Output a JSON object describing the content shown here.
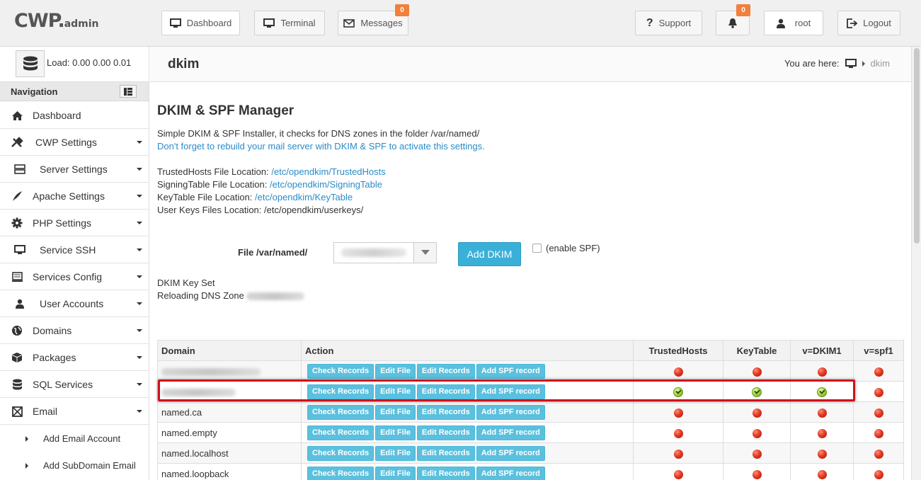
{
  "logo": {
    "main": "CWP",
    "dot": ".",
    "sub": "admin"
  },
  "topnav": {
    "dashboard": "Dashboard",
    "terminal": "Terminal",
    "messages": "Messages",
    "messages_count": "0",
    "support": "Support",
    "notifications_count": "0",
    "user": "root",
    "logout": "Logout"
  },
  "sidebar": {
    "load": "Load: 0.00  0.00  0.01",
    "nav_title": "Navigation",
    "items": [
      {
        "label": "Dashboard",
        "icon": "home-icon"
      },
      {
        "label": "CWP Settings",
        "icon": "tools-icon"
      },
      {
        "label": "Server Settings",
        "icon": "server-icon"
      },
      {
        "label": "Apache Settings",
        "icon": "feather-icon"
      },
      {
        "label": "PHP Settings",
        "icon": "gear-icon"
      },
      {
        "label": "Service SSH",
        "icon": "monitor-icon"
      },
      {
        "label": "Services Config",
        "icon": "list-icon"
      },
      {
        "label": "User Accounts",
        "icon": "user-icon"
      },
      {
        "label": "Domains",
        "icon": "globe-icon"
      },
      {
        "label": "Packages",
        "icon": "box-icon"
      },
      {
        "label": "SQL Services",
        "icon": "database-icon"
      },
      {
        "label": "Email",
        "icon": "envelope-icon"
      }
    ],
    "subitems": [
      {
        "label": "Add Email Account"
      },
      {
        "label": "Add SubDomain Email"
      }
    ]
  },
  "page": {
    "title": "dkim",
    "breadcrumb_label": "You are here:",
    "breadcrumb_current": "dkim"
  },
  "manager": {
    "heading": "DKIM & SPF Manager",
    "desc1": "Simple DKIM & SPF Installer, it checks for DNS zones in the folder /var/named/",
    "desc2": "Don't forget to rebuild your mail server with DKIM & SPF to activate this settings.",
    "trusted_label": "TrustedHosts File Location:",
    "trusted_path": "/etc/opendkim/TrustedHosts",
    "signing_label": "SigningTable File Location:",
    "signing_path": "/etc/opendkim/SigningTable",
    "keytable_label": "KeyTable File Location:",
    "keytable_path": "/etc/opendkim/KeyTable",
    "userkeys_label": "User Keys Files Location:",
    "userkeys_path": "/etc/opendkim/userkeys/",
    "file_label": "File /var/named/",
    "add_button": "Add DKIM",
    "enable_spf": "(enable SPF)",
    "status1": "DKIM Key Set",
    "status2": "Reloading DNS Zone"
  },
  "table": {
    "headers": [
      "Domain",
      "Action",
      "TrustedHosts",
      "KeyTable",
      "v=DKIM1",
      "v=spf1"
    ],
    "action_labels": {
      "check": "Check Records",
      "edit_file": "Edit File",
      "edit_records": "Edit Records",
      "add_spf": "Add SPF record"
    },
    "rows": [
      {
        "domain": "",
        "blurred": true,
        "trusted": "red",
        "keytable": "red",
        "dkim": "red",
        "spf": "red"
      },
      {
        "domain": "",
        "blurred": true,
        "trusted": "green",
        "keytable": "green",
        "dkim": "green",
        "spf": "red"
      },
      {
        "domain": "named.ca",
        "blurred": false,
        "trusted": "red",
        "keytable": "red",
        "dkim": "red",
        "spf": "red"
      },
      {
        "domain": "named.empty",
        "blurred": false,
        "trusted": "red",
        "keytable": "red",
        "dkim": "red",
        "spf": "red"
      },
      {
        "domain": "named.localhost",
        "blurred": false,
        "trusted": "red",
        "keytable": "red",
        "dkim": "red",
        "spf": "red"
      },
      {
        "domain": "named.loopback",
        "blurred": false,
        "trusted": "red",
        "keytable": "red",
        "dkim": "red",
        "spf": "red"
      }
    ]
  },
  "colors": {
    "accent": "#3ab0d8",
    "link": "#2a8bc8",
    "badge": "#f0803c",
    "highlight": "#d0111b"
  }
}
